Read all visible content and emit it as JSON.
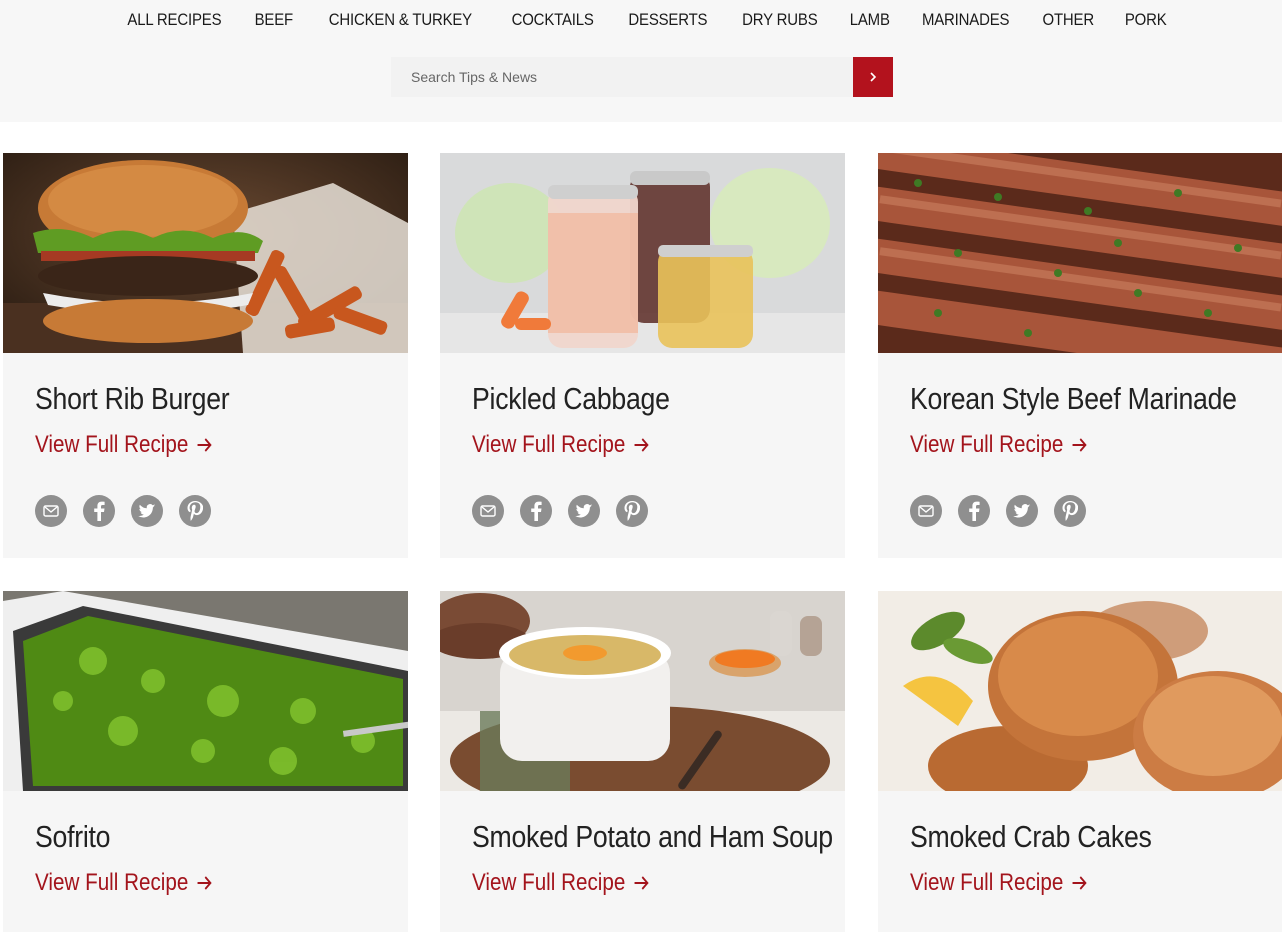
{
  "nav": {
    "items": [
      {
        "label": "ALL RECIPES"
      },
      {
        "label": "BEEF"
      },
      {
        "label": "CHICKEN & TURKEY"
      },
      {
        "label": "COCKTAILS"
      },
      {
        "label": "DESSERTS"
      },
      {
        "label": "DRY RUBS"
      },
      {
        "label": "LAMB"
      },
      {
        "label": "MARINADES"
      },
      {
        "label": "OTHER"
      },
      {
        "label": "PORK"
      }
    ]
  },
  "search": {
    "placeholder": "Search Tips & News",
    "value": ""
  },
  "colors": {
    "accent": "#b3121d",
    "link": "#a3141c",
    "card_bg": "#f6f6f6",
    "share_icon": "#8f8f8f"
  },
  "cards": [
    {
      "title": "Short Rib Burger",
      "link_label": "View Full Recipe",
      "image": "burger-with-fries-photo",
      "share": [
        "email-icon",
        "facebook-icon",
        "twitter-icon",
        "pinterest-icon"
      ]
    },
    {
      "title": "Pickled Cabbage",
      "link_label": "View Full Recipe",
      "image": "pickle-jars-photo",
      "share": [
        "email-icon",
        "facebook-icon",
        "twitter-icon",
        "pinterest-icon"
      ]
    },
    {
      "title": "Korean Style Beef Marinade",
      "link_label": "View Full Recipe",
      "image": "marinated-short-ribs-photo",
      "share": [
        "email-icon",
        "facebook-icon",
        "twitter-icon",
        "pinterest-icon"
      ]
    },
    {
      "title": "Sofrito",
      "link_label": "View Full Recipe",
      "image": "green-sofrito-tray-photo"
    },
    {
      "title": "Smoked Potato and Ham Soup",
      "link_label": "View Full Recipe",
      "image": "soup-pot-photo"
    },
    {
      "title": "Smoked Crab Cakes",
      "link_label": "View Full Recipe",
      "image": "crab-cakes-photo"
    }
  ]
}
